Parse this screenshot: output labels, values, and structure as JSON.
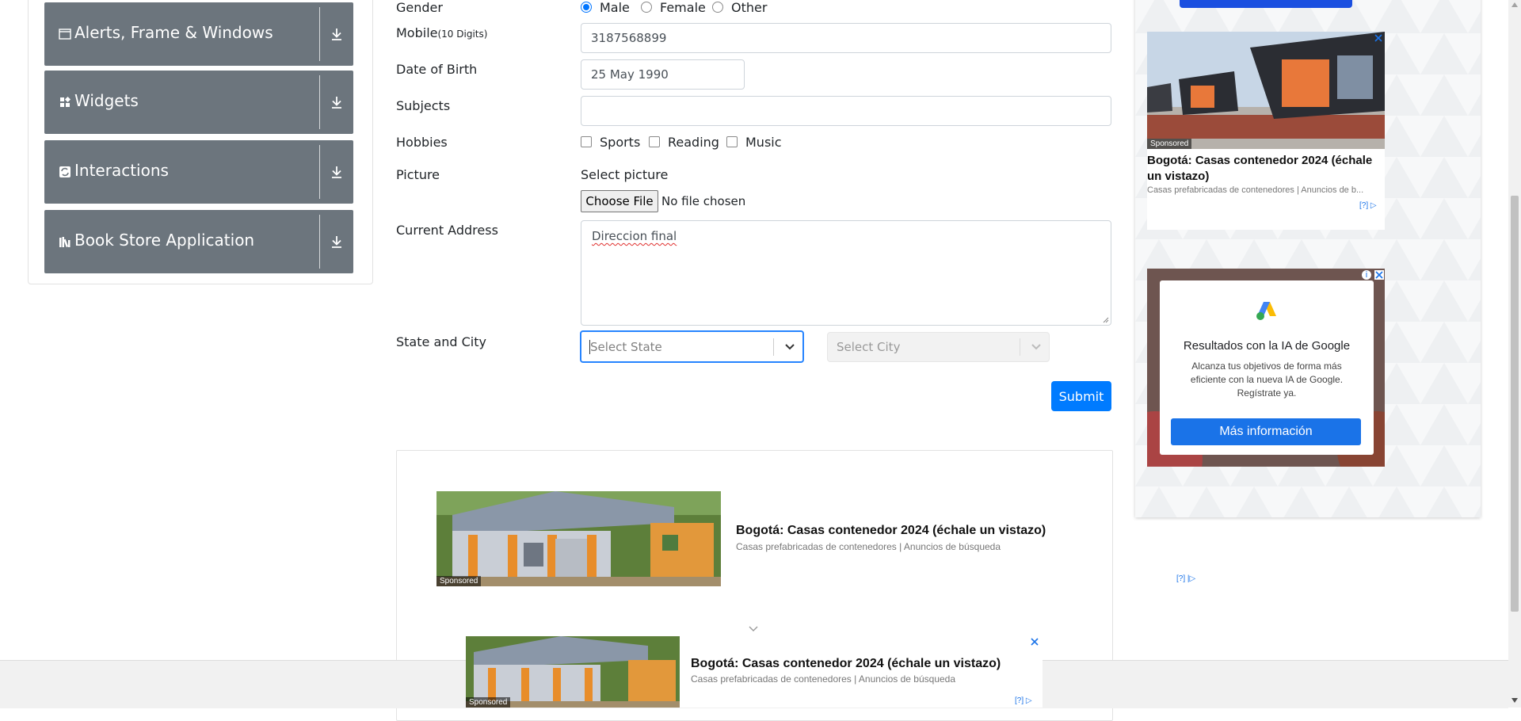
{
  "nav": {
    "groups": [
      {
        "label": "Alerts, Frame & Windows",
        "icon": "window-icon"
      },
      {
        "label": "Widgets",
        "icon": "widgets-icon"
      },
      {
        "label": "Interactions",
        "icon": "interactions-icon"
      },
      {
        "label": "Book Store Application",
        "icon": "bookstore-icon"
      }
    ]
  },
  "form": {
    "gender_label": "Gender",
    "gender_options": [
      "Male",
      "Female",
      "Other"
    ],
    "gender_selected": "Male",
    "mobile_label": "Mobile",
    "mobile_hint": "(10 Digits)",
    "mobile_value": "3187568899",
    "dob_label": "Date of Birth",
    "dob_value": "25 May 1990",
    "subjects_label": "Subjects",
    "subjects_value": "",
    "hobbies_label": "Hobbies",
    "hobbies": [
      "Sports",
      "Reading",
      "Music"
    ],
    "picture_label": "Picture",
    "picture_select_text": "Select picture",
    "choose_file_label": "Choose File",
    "no_file_text": "No file chosen",
    "address_label": "Current Address",
    "address_value": "Direccion final",
    "state_city_label": "State and City",
    "state_placeholder": "Select State",
    "city_placeholder": "Select City",
    "submit_label": "Submit"
  },
  "ads": {
    "right_top": {
      "title": "Bogotá: Casas contenedor 2024 (échale un vistazo)",
      "subtitle": "Casas prefabricadas de contenedores | Anuncios de b...",
      "sponsored": "Sponsored",
      "help": "[?]"
    },
    "right_google": {
      "title": "Resultados con la IA de Google",
      "body": "Alcanza tus objetivos de forma más eficiente con la nueva IA de Google. Regístrate ya.",
      "cta": "Más información"
    },
    "center": {
      "title": "Bogotá: Casas contenedor 2024 (échale un vistazo)",
      "subtitle": "Casas prefabricadas de contenedores | Anuncios de búsqueda",
      "sponsored": "Sponsored",
      "help": "[?]"
    },
    "bottom": {
      "title": "Bogotá: Casas contenedor 2024 (échale un vistazo)",
      "subtitle": "Casas prefabricadas de contenedores | Anuncios de búsqueda",
      "sponsored": "Sponsored",
      "help": "[?]"
    }
  },
  "colors": {
    "nav_group_bg": "#6c757d",
    "primary": "#007bff",
    "google_cta": "#1a73e8"
  }
}
